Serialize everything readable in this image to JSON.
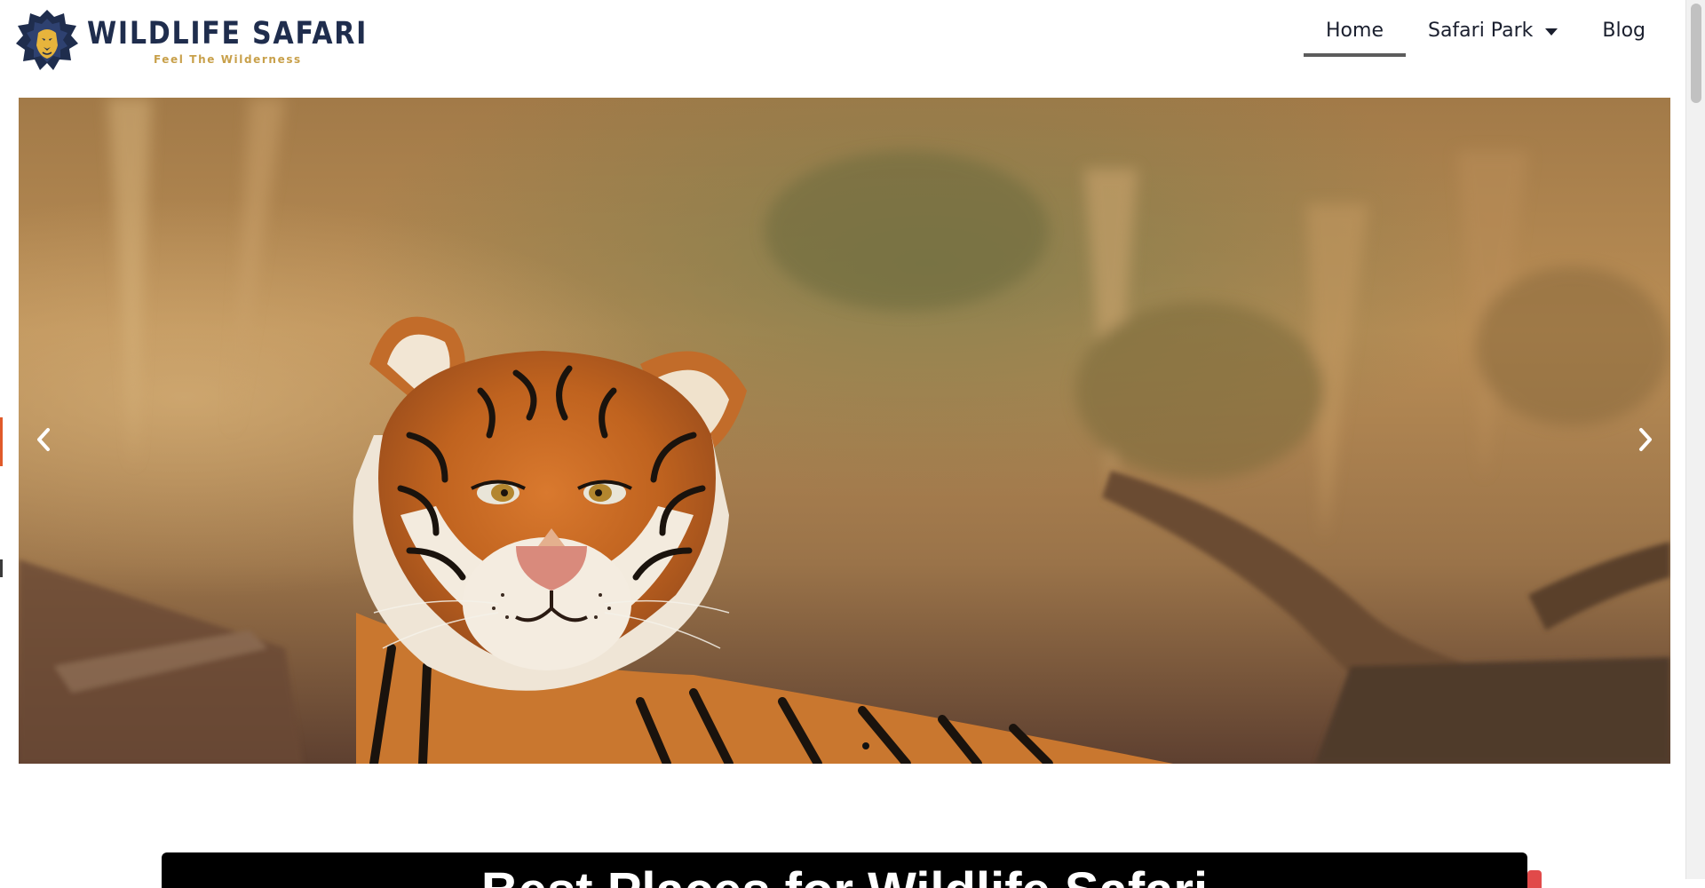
{
  "brand": {
    "title": "WILDLIFE SAFARI",
    "tagline": "Feel The Wilderness",
    "colors": {
      "navy": "#1f2d4d",
      "gold": "#c8a04a"
    }
  },
  "nav": {
    "items": [
      {
        "label": "Home",
        "active": true
      },
      {
        "label": "Safari Park",
        "has_dropdown": true
      },
      {
        "label": "Blog"
      }
    ]
  },
  "slider": {
    "slide_alt": "Tiger resting in dry grassland",
    "prev_icon": "chevron-left-icon",
    "next_icon": "chevron-right-icon",
    "current_slide": 1,
    "total_slides": 1
  },
  "section": {
    "title": "Best Places for Wildlife Safari"
  }
}
